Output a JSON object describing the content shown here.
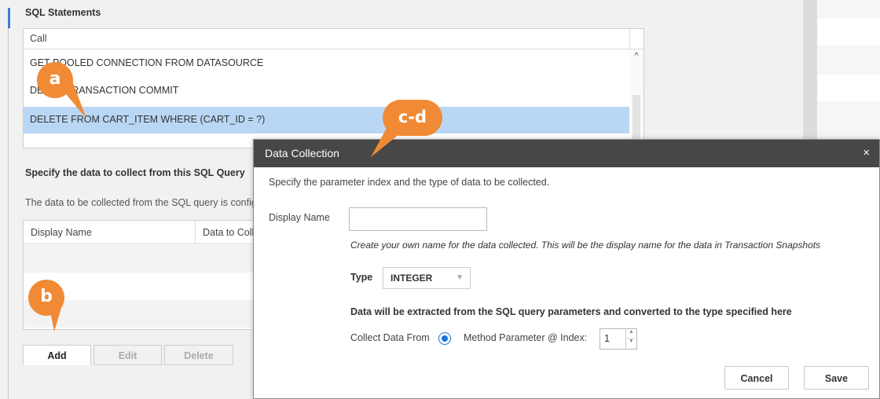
{
  "sql_section": {
    "title": "SQL Statements",
    "header": "Call",
    "rows": [
      "GET POOLED CONNECTION FROM DATASOURCE",
      "DEFER TRANSACTION COMMIT",
      "DELETE FROM CART_ITEM WHERE (CART_ID = ?)"
    ],
    "selected_index": 2
  },
  "spec_section": {
    "title": "Specify the data to collect from this SQL Query",
    "description": "The data to be collected from the SQL query is configured here",
    "columns": [
      "Display Name",
      "Data to Collect"
    ]
  },
  "actions": {
    "add": "Add",
    "edit": "Edit",
    "delete": "Delete"
  },
  "callouts": {
    "a": "a",
    "b": "b",
    "cd": "c-d"
  },
  "dialog": {
    "title": "Data Collection",
    "close": "×",
    "intro": "Specify the parameter index and the type of data to be collected.",
    "display_name_label": "Display Name",
    "display_name_value": "",
    "display_name_help": "Create your own name for the data collected.  This will be the display name for the data in Transaction Snapshots",
    "type_label": "Type",
    "type_value": "INTEGER",
    "extract_note": "Data will be extracted from the SQL query parameters and converted to the type specified here",
    "collect_from_label": "Collect Data From",
    "method_param_label": "Method Parameter @ Index:",
    "index_value": "1",
    "cancel": "Cancel",
    "save": "Save"
  },
  "colors": {
    "callout": "#f08a34",
    "selected_row": "#b9d7f5",
    "titlebar": "#474747",
    "radio": "#1a73d9"
  }
}
